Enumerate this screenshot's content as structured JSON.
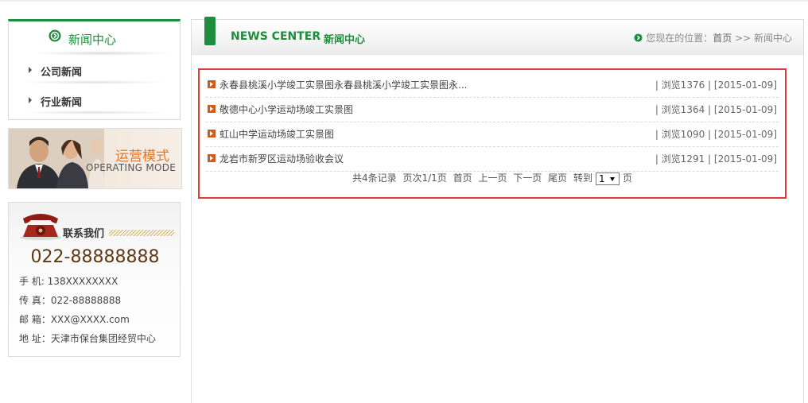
{
  "sidebar": {
    "title": "新闻中心",
    "items": [
      {
        "label": "公司新闻"
      },
      {
        "label": "行业新闻"
      }
    ]
  },
  "banner": {
    "cn": "运营模式",
    "en": "OPERATING MODE"
  },
  "contact": {
    "title": "联系我们",
    "phone": "022-88888888",
    "mobile": "手 机: 138XXXXXXXX",
    "fax": "传 真：022-88888888",
    "email": "邮 箱：XXX@XXXX.com",
    "address": "地 址：天津市保台集团经贸中心"
  },
  "main": {
    "title_en": "NEWS CENTER",
    "title_cn": "新闻中心",
    "breadcrumb": {
      "prefix": "您现在的位置：",
      "home": "首页",
      "separator": ">>",
      "current": "新闻中心"
    },
    "news": [
      {
        "title": "永春县桃溪小学竣工实景图永春县桃溪小学竣工实景图永...",
        "meta": "| 浏览1376 | [2015-01-09]"
      },
      {
        "title": "敬德中心小学运动场竣工实景图",
        "meta": "| 浏览1364 | [2015-01-09]"
      },
      {
        "title": "虹山中学运动场竣工实景图",
        "meta": "| 浏览1090 | [2015-01-09]"
      },
      {
        "title": "龙岩市新罗区运动场验收会议",
        "meta": "| 浏览1291 | [2015-01-09]"
      }
    ],
    "pager": {
      "total": "共4条记录",
      "pages": "页次1/1页",
      "first": "首页",
      "prev": "上一页",
      "next": "下一页",
      "last": "尾页",
      "goto": "转到",
      "page_value": "1",
      "page_suffix": "页"
    }
  },
  "colors": {
    "brand_green": "#1e8e3e",
    "highlight_border": "#e03a3a",
    "bullet_orange": "#cf5b1a"
  }
}
